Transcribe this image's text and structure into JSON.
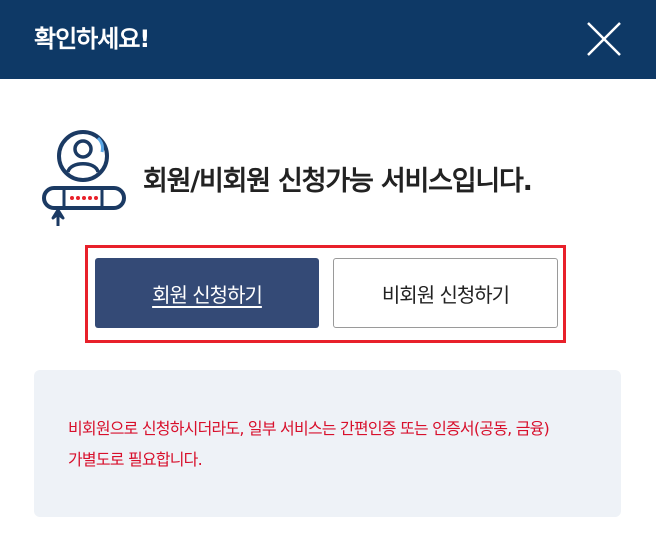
{
  "header": {
    "title": "확인하세요!",
    "close_icon": "close-icon"
  },
  "intro": {
    "icon": "member-login-icon",
    "text": "회원/비회원 신청가능 서비스입니다."
  },
  "buttons": {
    "member_label": "회원 신청하기",
    "guest_label": "비회원 신청하기"
  },
  "notice": {
    "line1": "비회원으로 신청하시더라도, 일부 서비스는 간편인증 또는 인증서(공동, 금융)",
    "line2": "가별도로 필요합니다."
  },
  "colors": {
    "header_bg": "#0e3966",
    "primary_button": "#344a76",
    "highlight_border": "#e8202a",
    "notice_text": "#d8102c",
    "notice_bg": "#eef2f7"
  }
}
